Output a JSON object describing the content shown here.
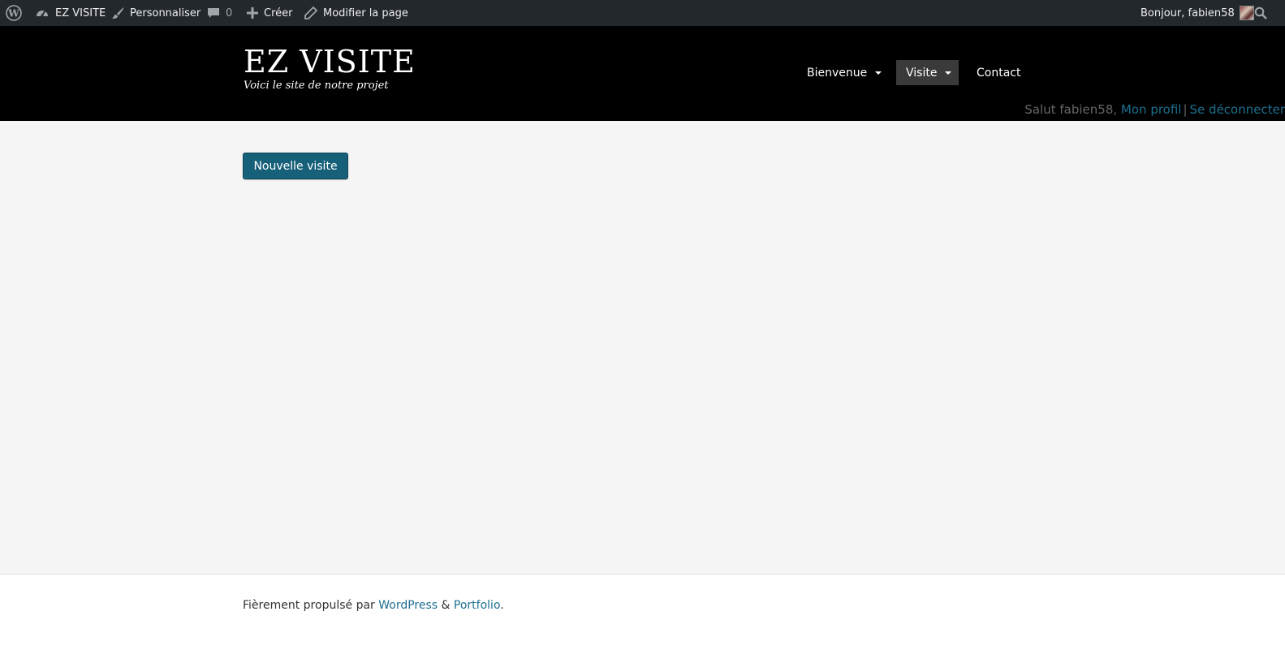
{
  "admin_bar": {
    "site_name": "EZ VISITE",
    "customize": "Personnaliser",
    "comments_count": "0",
    "new": "Créer",
    "edit_page": "Modifier la page",
    "greeting": "Bonjour, fabien58"
  },
  "header": {
    "site_title": "EZ VISITE",
    "site_description": "Voici le site de notre projet",
    "menu": [
      {
        "label": "Bienvenue"
      },
      {
        "label": "Visite"
      },
      {
        "label": "Contact"
      }
    ],
    "user_greeting": "Salut fabien58,",
    "profile_link": "Mon profil",
    "separator": "|",
    "logout_link": "Se déconnecter"
  },
  "main": {
    "new_visit_button": "Nouvelle visite"
  },
  "footer": {
    "prefix": "Fièrement propulsé par",
    "wordpress": "WordPress",
    "amp": "&",
    "theme": "Portfolio",
    "end": "."
  },
  "colors": {
    "admin_bar_bg": "#23282d",
    "header_bg": "#000000",
    "button_bg": "#17607a",
    "link": "#1e6f8f",
    "content_bg": "#f5f5f5"
  }
}
